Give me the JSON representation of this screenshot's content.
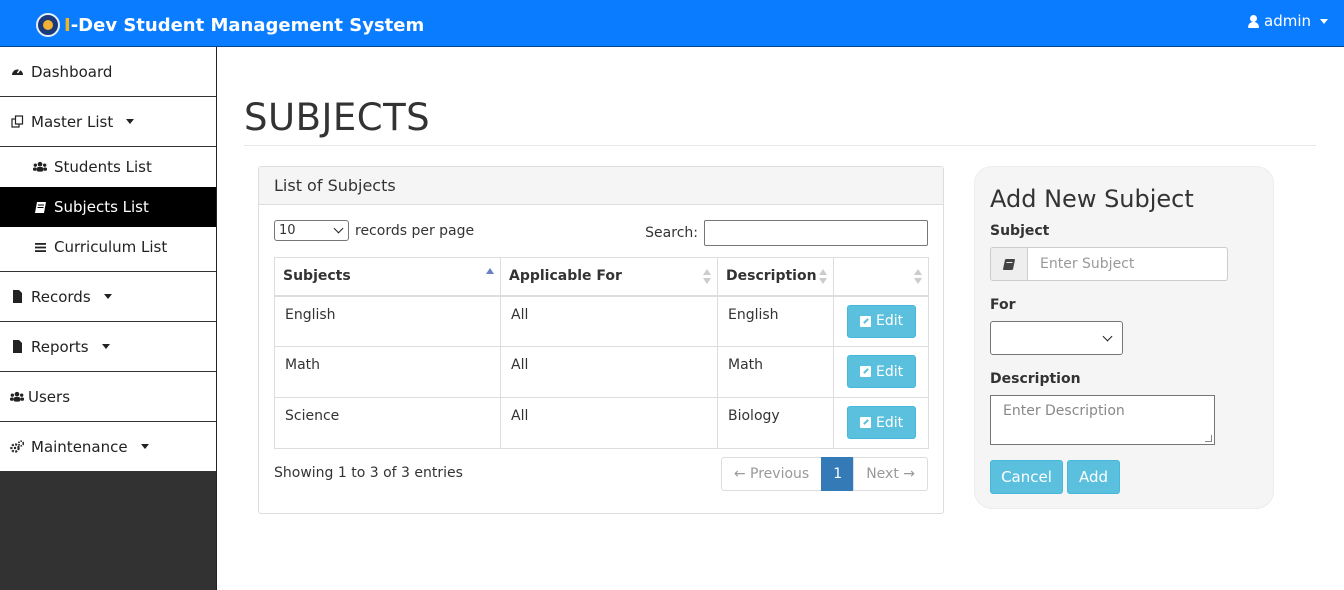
{
  "header": {
    "brand_i": "I",
    "brand_text": "-Dev Student Management System",
    "user_label": "admin"
  },
  "sidebar": {
    "items": [
      {
        "label": "Dashboard",
        "icon": "dashboard-icon"
      },
      {
        "label": "Master List",
        "icon": "clone-icon",
        "dropdown": true
      },
      {
        "label": "Students List",
        "icon": "users-icon"
      },
      {
        "label": "Subjects List",
        "icon": "book-icon",
        "active": true
      },
      {
        "label": "Curriculum List",
        "icon": "list-icon"
      },
      {
        "label": "Records",
        "icon": "file-icon",
        "dropdown": true
      },
      {
        "label": "Reports",
        "icon": "file-icon",
        "dropdown": true
      },
      {
        "label": "Users",
        "icon": "users-icon"
      },
      {
        "label": "Maintenance",
        "icon": "cogs-icon",
        "dropdown": true
      }
    ]
  },
  "page": {
    "title": "SUBJECTS"
  },
  "list_panel": {
    "heading": "List of Subjects",
    "length_value": "10",
    "length_label": "records per page",
    "search_label": "Search:",
    "search_value": "",
    "columns": [
      "Subjects",
      "Applicable For",
      "Description",
      ""
    ],
    "rows": [
      {
        "subject": "English",
        "applicable": "All",
        "description": "English",
        "action": "Edit"
      },
      {
        "subject": "Math",
        "applicable": "All",
        "description": "Math",
        "action": "Edit"
      },
      {
        "subject": "Science",
        "applicable": "All",
        "description": "Biology",
        "action": "Edit"
      }
    ],
    "info": "Showing 1 to 3 of 3 entries",
    "pager": {
      "previous": "← Previous",
      "current": "1",
      "next": "Next →"
    }
  },
  "add_form": {
    "title": "Add New Subject",
    "subject_label": "Subject",
    "subject_placeholder": "Enter Subject",
    "for_label": "For",
    "for_value": "",
    "description_label": "Description",
    "description_placeholder": "Enter Description",
    "cancel_label": "Cancel",
    "add_label": "Add"
  },
  "colors": {
    "navbar": "#0a7cff",
    "info_button": "#5bc0de",
    "active_page": "#337ab7",
    "sidebar_active": "#000000"
  }
}
